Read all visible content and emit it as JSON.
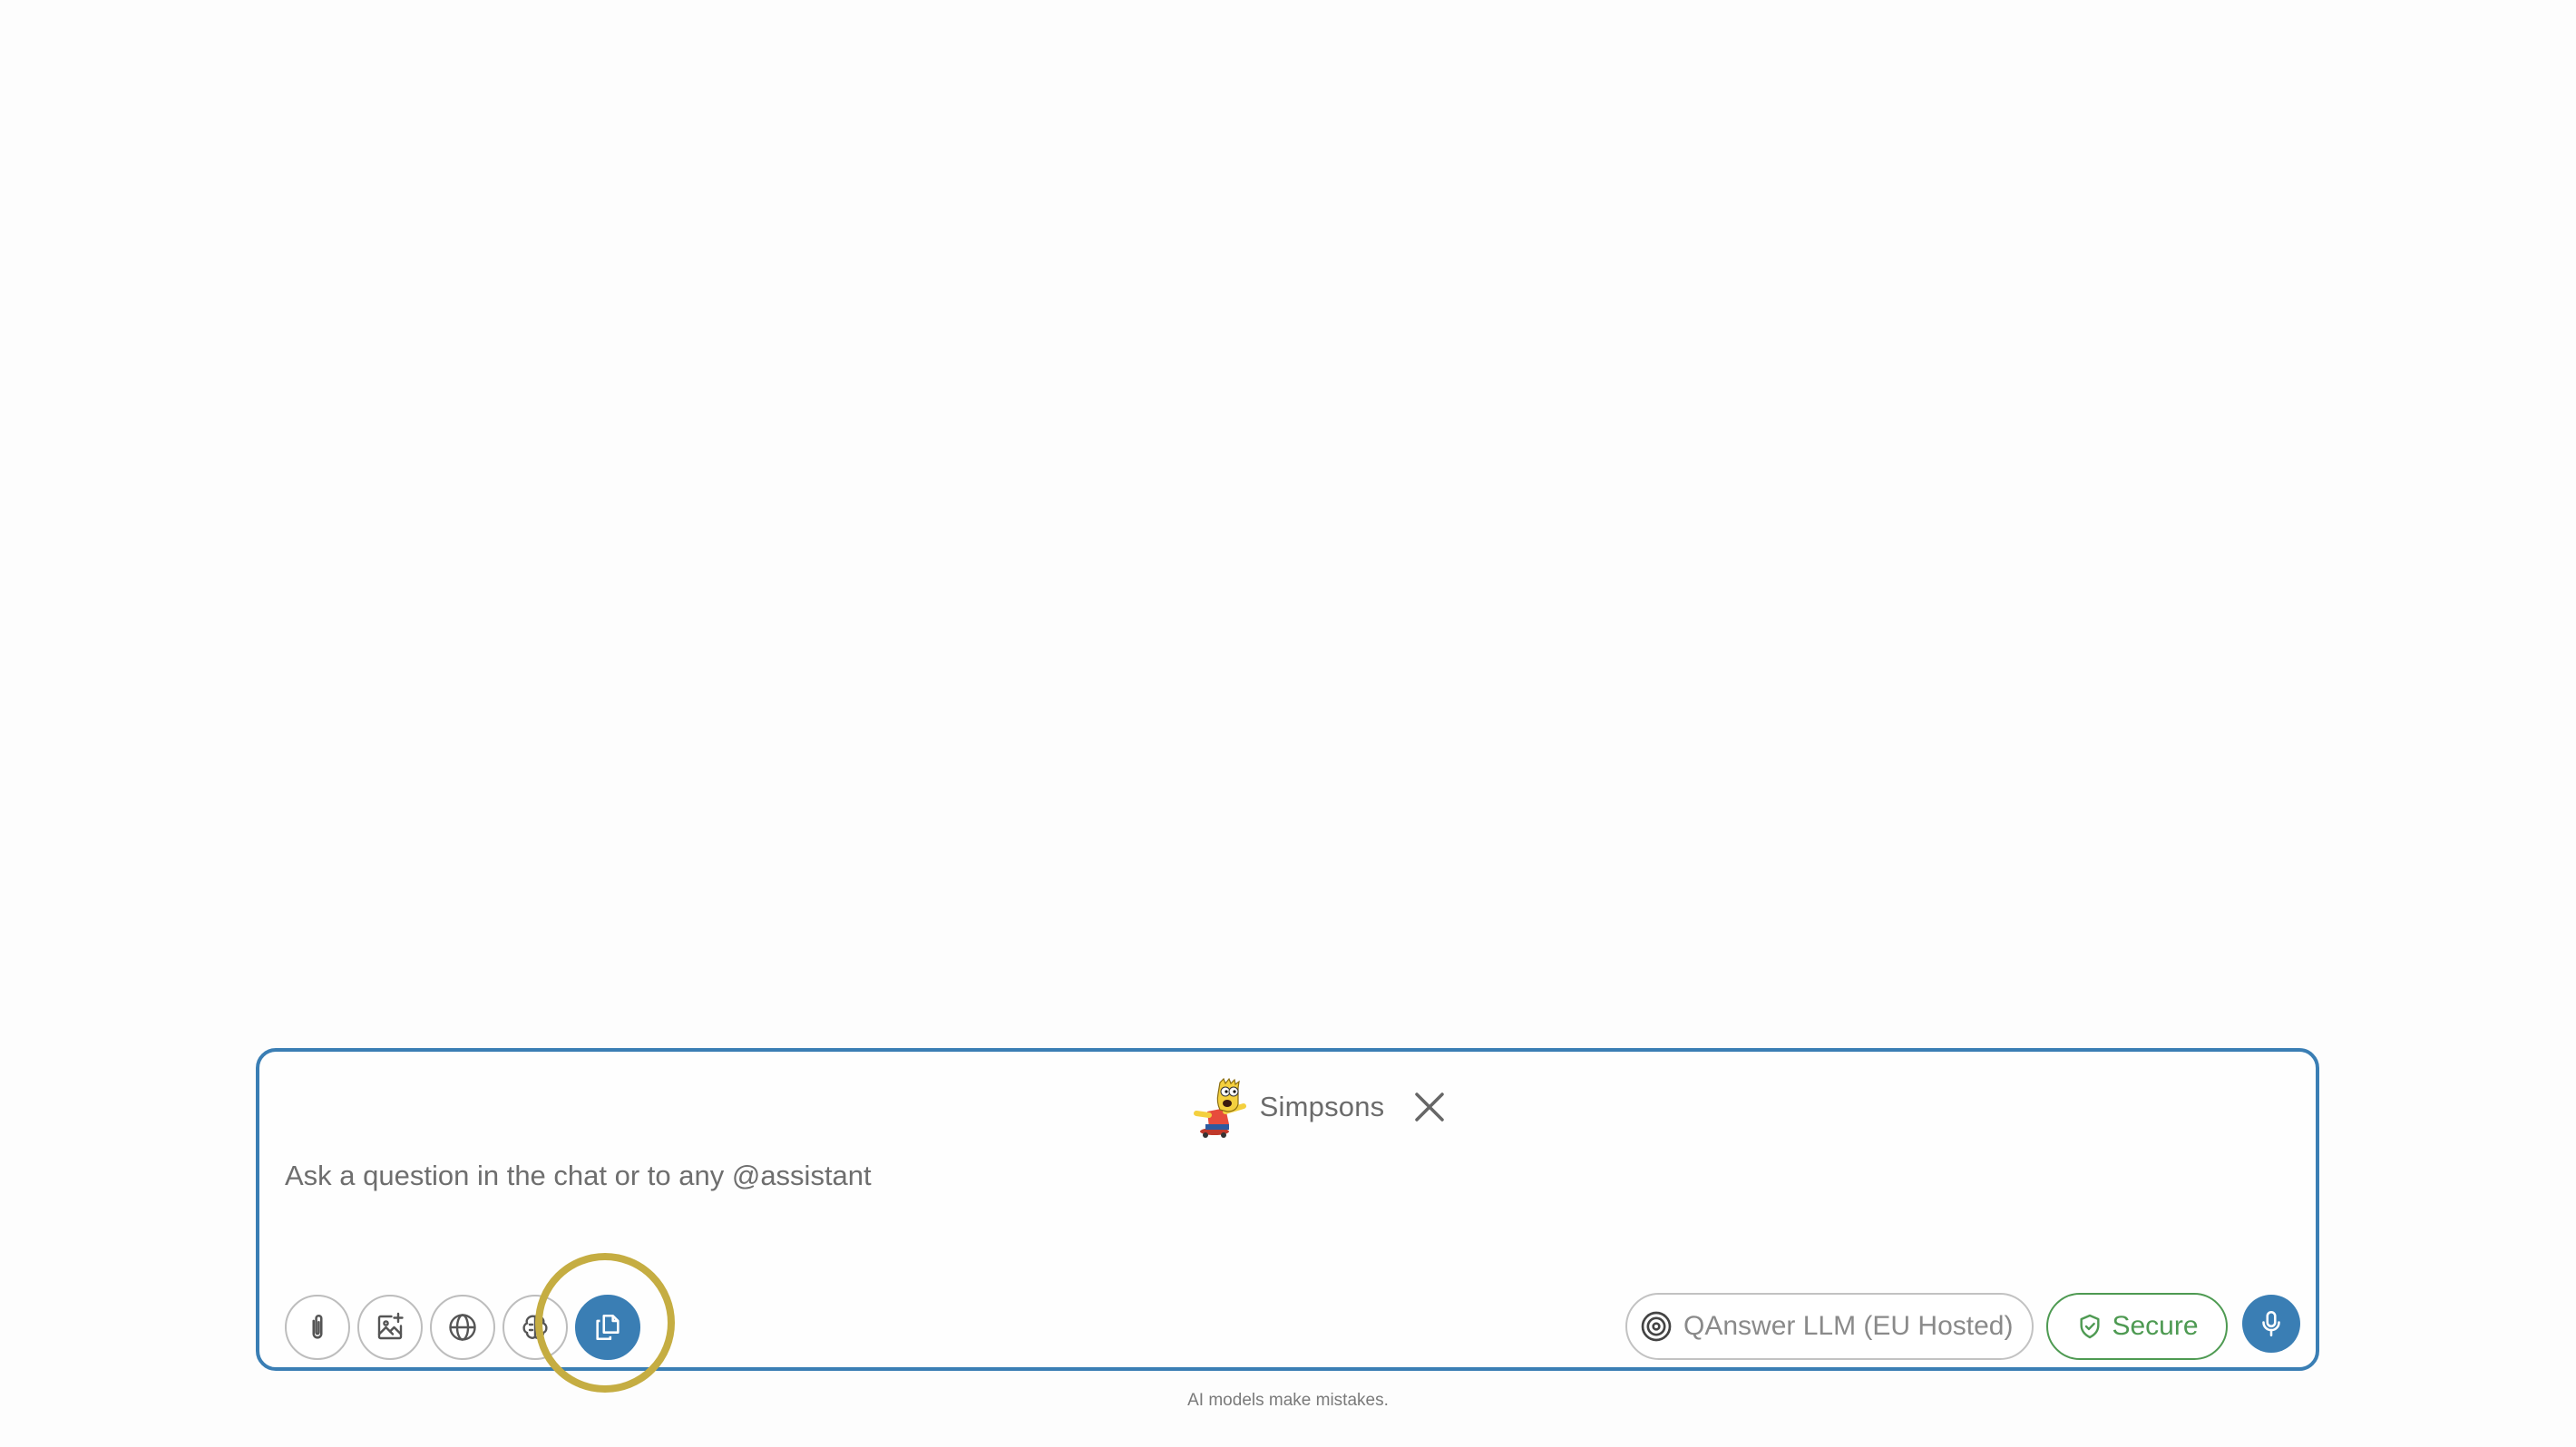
{
  "composer": {
    "assistant_chip": {
      "label": "Simpsons",
      "avatar_icon": "bart-simpson-avatar",
      "close_icon": "close-icon"
    },
    "input": {
      "placeholder": "Ask a question in the chat or to any @assistant",
      "value": ""
    },
    "toolbar": {
      "buttons": [
        {
          "name": "attach-file-button",
          "icon": "paperclip-icon",
          "active": false
        },
        {
          "name": "add-image-button",
          "icon": "image-plus-icon",
          "active": false
        },
        {
          "name": "web-search-button",
          "icon": "globe-icon",
          "active": false
        },
        {
          "name": "reasoning-button",
          "icon": "brain-icon",
          "active": false
        },
        {
          "name": "documents-button",
          "icon": "copy-documents-icon",
          "active": true
        }
      ],
      "model_selector": {
        "label": "QAnswer LLM (EU Hosted)",
        "icon": "target-icon"
      },
      "secure_badge": {
        "label": "Secure",
        "icon": "shield-check-icon"
      },
      "voice_button": {
        "icon": "microphone-icon"
      }
    },
    "colors": {
      "accent": "#3a7eb4",
      "secure": "#4e9a52",
      "highlight": "#c5ad42"
    }
  },
  "footer": {
    "disclaimer": "AI models make mistakes."
  }
}
